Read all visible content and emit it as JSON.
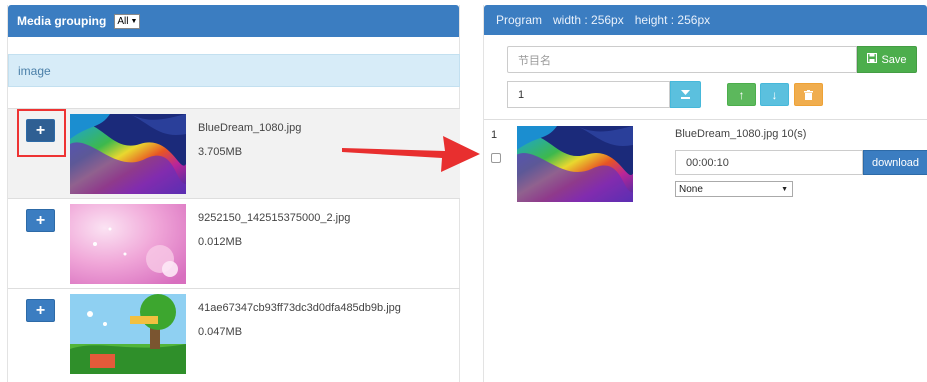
{
  "left": {
    "header_title": "Media grouping",
    "group_select": "All",
    "section_label": "image",
    "items": [
      {
        "add": "+",
        "name": "BlueDream_1080.jpg",
        "size": "3.705MB"
      },
      {
        "add": "+",
        "name": "9252150_142515375000_2.jpg",
        "size": "0.012MB"
      },
      {
        "add": "+",
        "name": "41ae67347cb93ff73dc3d0dfa485db9b.jpg",
        "size": "0.047MB"
      }
    ]
  },
  "right": {
    "header": {
      "program": "Program",
      "width": "width : 256px",
      "height": "height : 256px"
    },
    "name_placeholder": "节目名",
    "save_label": "Save",
    "number_value": "1",
    "program_items": [
      {
        "index": "1",
        "title": "BlueDream_1080.jpg 10(s)",
        "duration": "00:00:10",
        "download_label": "download",
        "effect": "None"
      }
    ]
  },
  "colors": {
    "primary": "#3b7dc1",
    "success": "#5cb85c",
    "info": "#5bc0de",
    "warning": "#f0ad4e",
    "highlight": "#ee3333"
  }
}
